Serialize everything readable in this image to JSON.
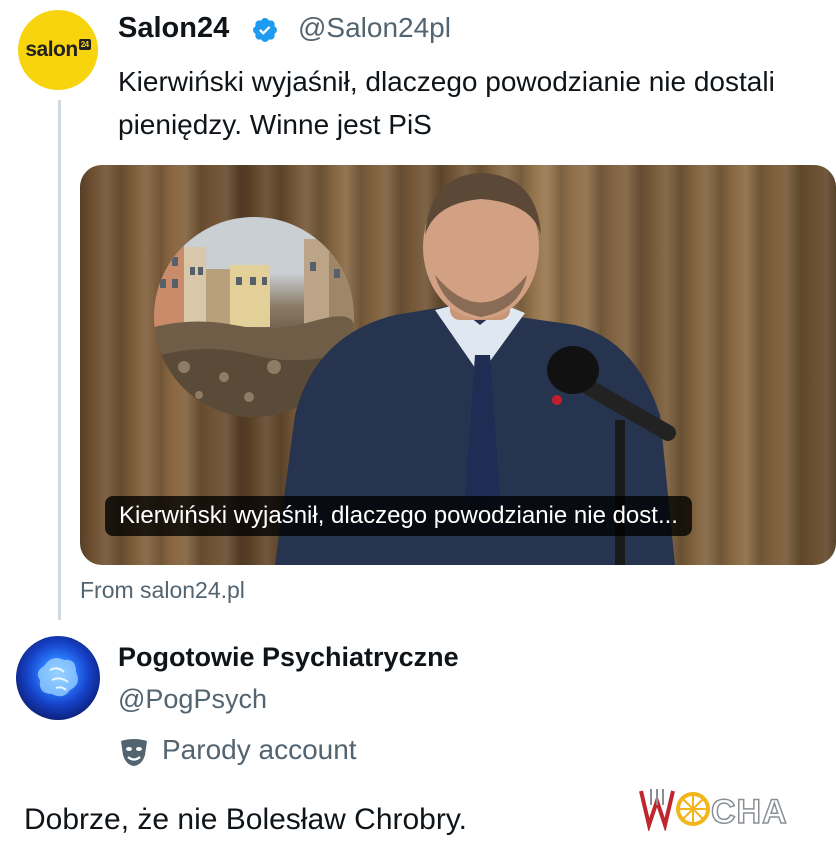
{
  "tweet": {
    "display_name": "Salon24",
    "handle": "@Salon24pl",
    "avatar_logo": "salon",
    "avatar_badge": "24",
    "verified_icon": "verified-badge-icon",
    "text": "Kierwiński wyjaśnił, dlaczego powodzianie nie dostali pieniędzy. Winne jest PiS",
    "media": {
      "caption": "Kierwiński wyjaśnił, dlaczego powodzianie nie dost..."
    },
    "source": "From salon24.pl"
  },
  "reply": {
    "display_name": "Pogotowie Psychiatryczne",
    "handle": "@PogPsych",
    "account_label": "Parody account",
    "account_icon": "theater-mask-icon"
  },
  "comment": "Dobrze, że nie Bolesław Chrobry.",
  "watermark": {
    "text": "WIOCHA",
    "color": "#c0262d"
  },
  "colors": {
    "verified": "#1d9bf0",
    "secondary_text": "#536471",
    "salon_yellow": "#f8d40e"
  }
}
